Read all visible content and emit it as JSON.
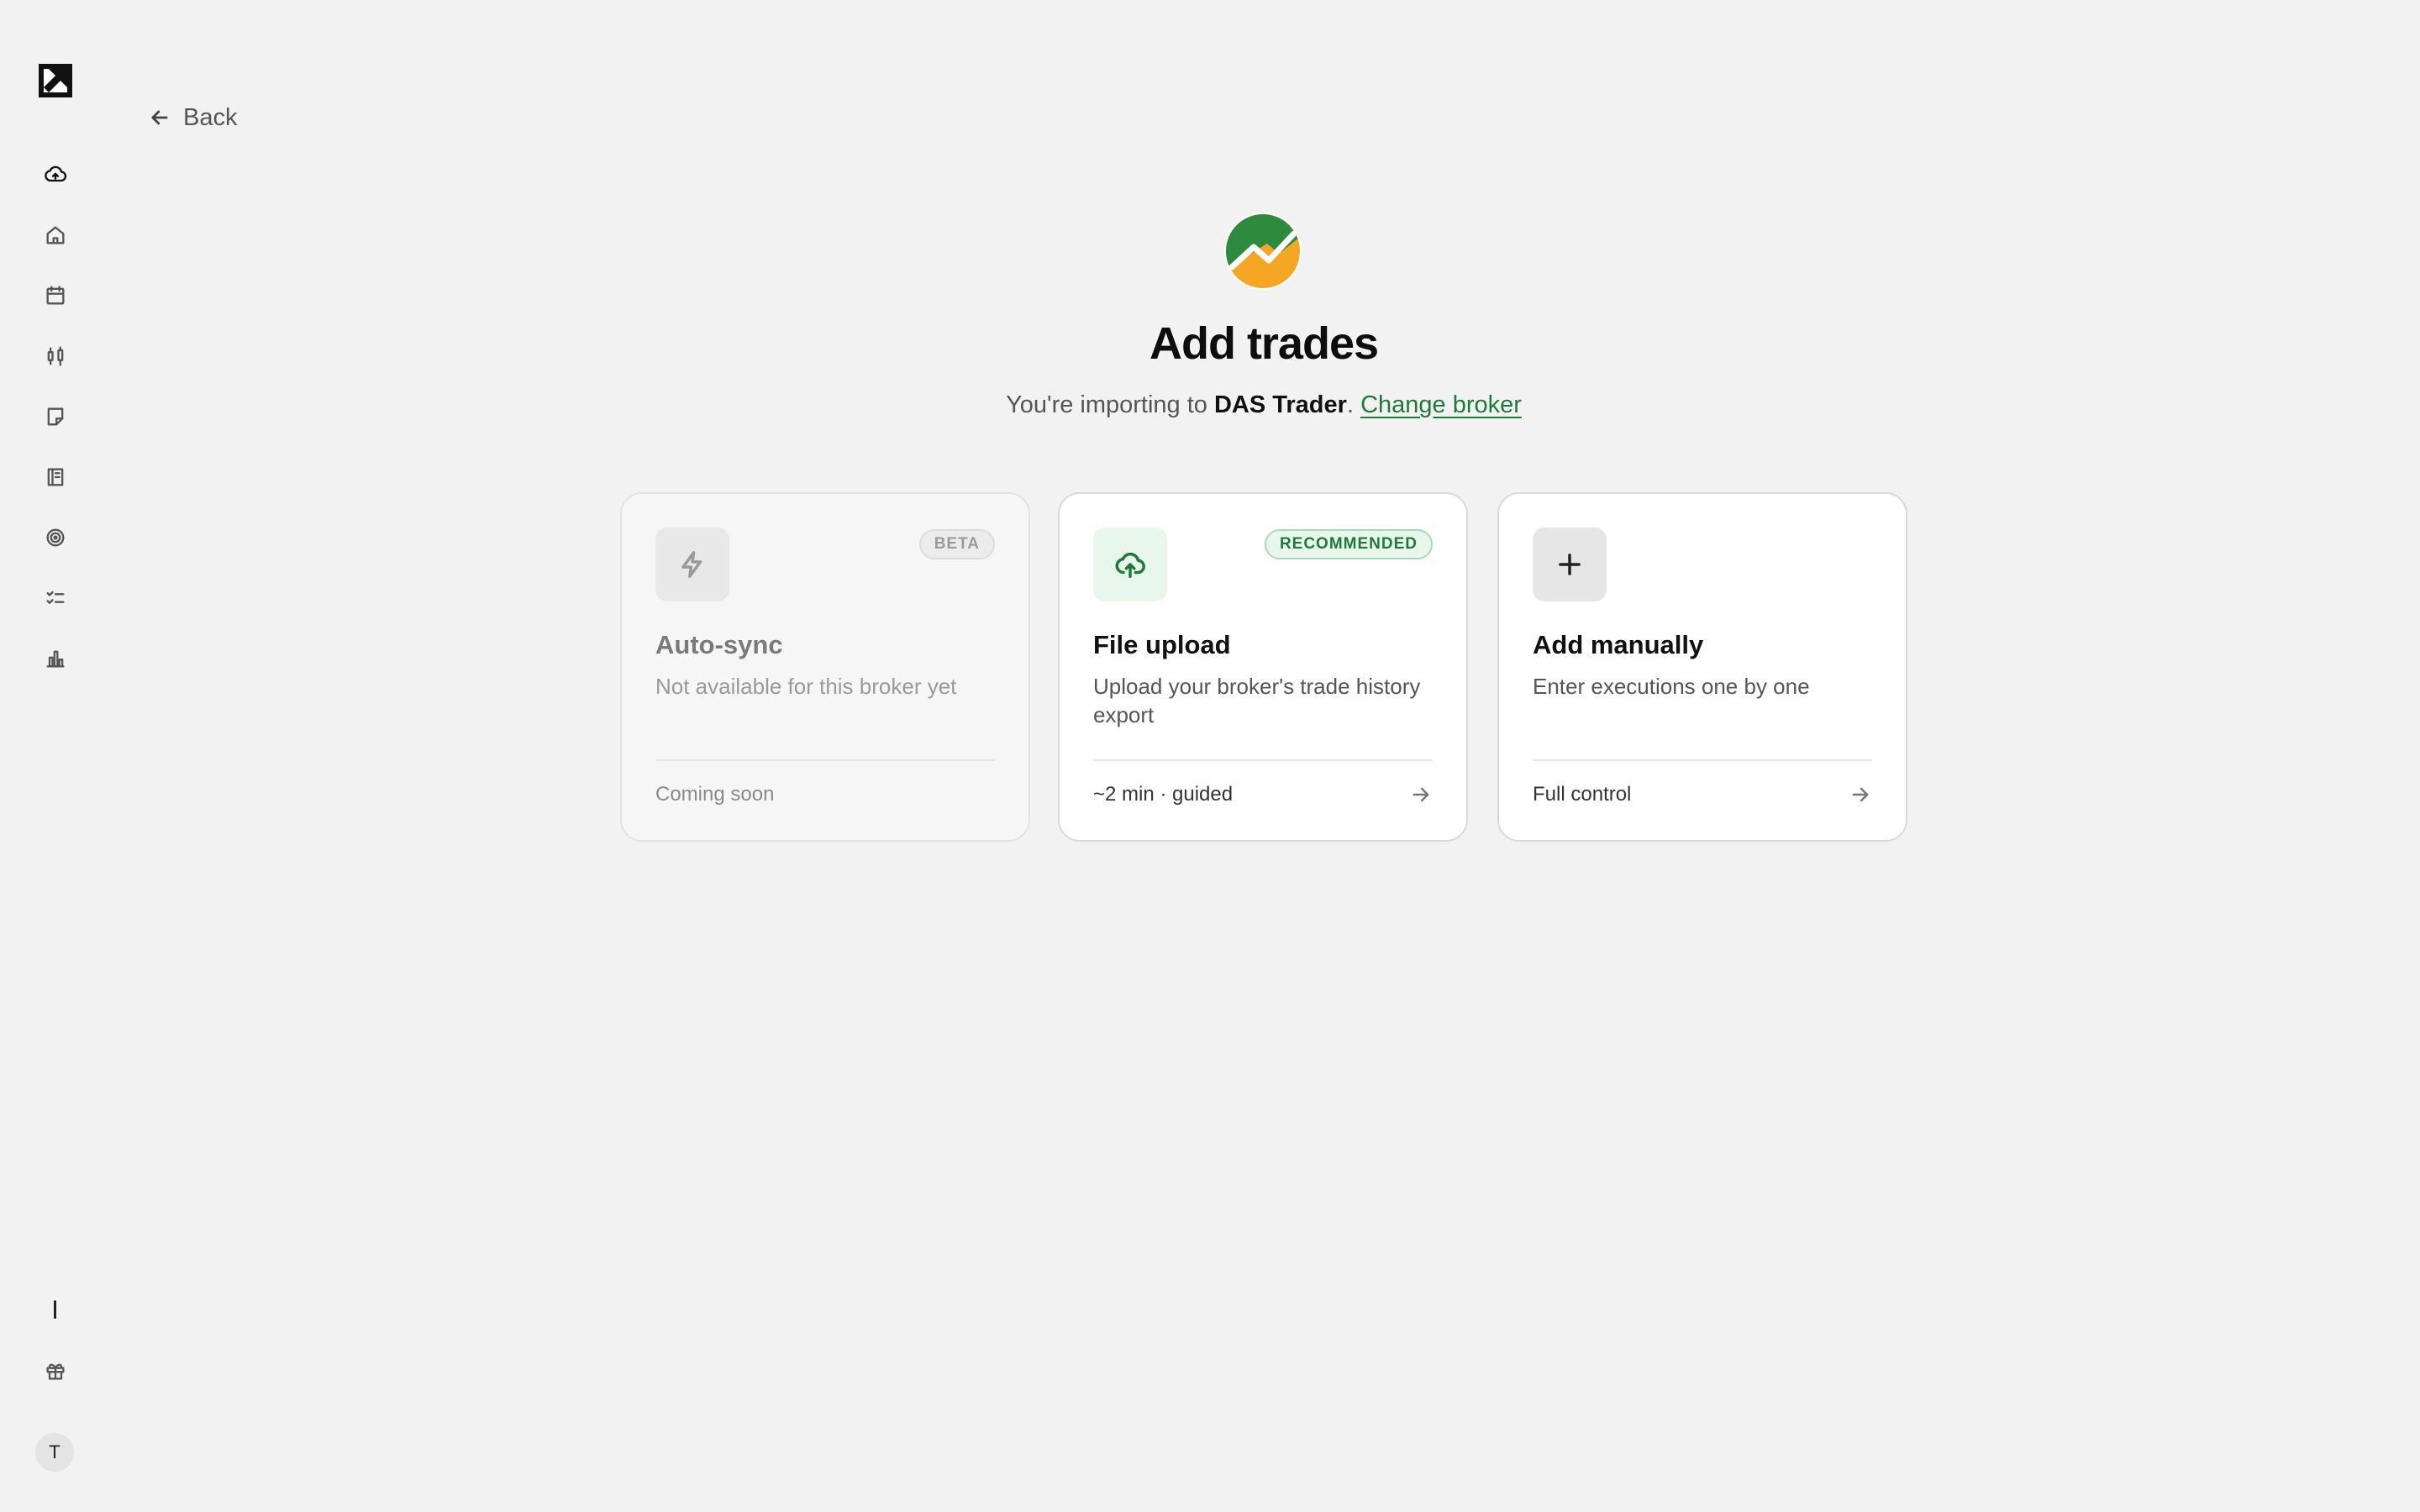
{
  "sidebar": {
    "items": [
      {
        "icon": "cloud-upload-icon",
        "active": true
      },
      {
        "icon": "home-icon"
      },
      {
        "icon": "calendar-icon"
      },
      {
        "icon": "candlestick-icon"
      },
      {
        "icon": "note-icon"
      },
      {
        "icon": "notebook-icon"
      },
      {
        "icon": "target-icon"
      },
      {
        "icon": "checklist-icon"
      },
      {
        "icon": "bar-chart-icon"
      }
    ],
    "bottom": [
      {
        "icon": "gift-icon"
      }
    ],
    "avatar_initial": "T"
  },
  "back_label": "Back",
  "header": {
    "title": "Add trades",
    "subtitle_prefix": "You're importing to ",
    "broker_name": "DAS Trader",
    "subtitle_sep": ". ",
    "change_broker": "Change broker"
  },
  "cards": [
    {
      "title": "Auto-sync",
      "description": "Not available for this broker yet",
      "badge": "BETA",
      "footer": "Coming soon",
      "icon": "lightning-icon",
      "enabled": false
    },
    {
      "title": "File upload",
      "description": "Upload your broker's trade history export",
      "badge": "RECOMMENDED",
      "footer": "~2 min · guided",
      "icon": "cloud-upload-icon",
      "enabled": true
    },
    {
      "title": "Add manually",
      "description": "Enter executions one by one",
      "badge": "",
      "footer": "Full control",
      "icon": "plus-icon",
      "enabled": true
    }
  ],
  "colors": {
    "background": "#f2f2f2",
    "accent_green": "#1f7a3a",
    "recommended_bg": "#e8f6ec",
    "logo_green": "#2e8b3e",
    "logo_orange": "#f5a623"
  }
}
